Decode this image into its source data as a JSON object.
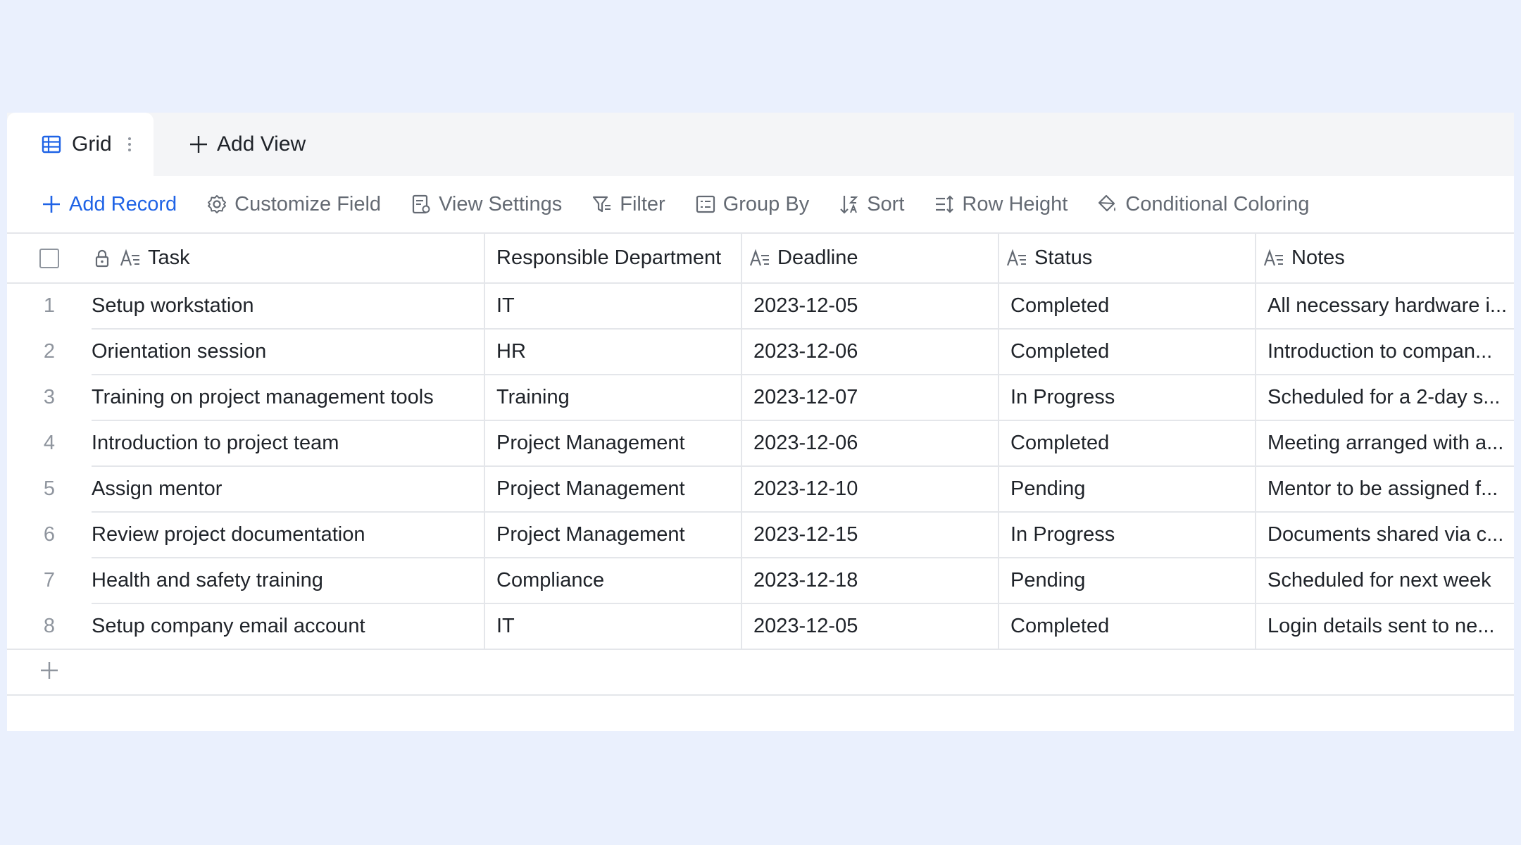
{
  "tabs": {
    "active_label": "Grid",
    "add_view_label": "Add View"
  },
  "toolbar": {
    "add_record": "Add Record",
    "customize_field": "Customize Field",
    "view_settings": "View Settings",
    "filter": "Filter",
    "group_by": "Group By",
    "sort": "Sort",
    "row_height": "Row Height",
    "conditional_coloring": "Conditional Coloring"
  },
  "table": {
    "columns": [
      "Task",
      "Responsible Department",
      "Deadline",
      "Status",
      "Notes"
    ],
    "rows": [
      {
        "index": "1",
        "task": "Setup workstation",
        "department": "IT",
        "deadline": "2023-12-05",
        "status": "Completed",
        "notes": "All necessary hardware i..."
      },
      {
        "index": "2",
        "task": "Orientation session",
        "department": "HR",
        "deadline": "2023-12-06",
        "status": "Completed",
        "notes": "Introduction to compan..."
      },
      {
        "index": "3",
        "task": "Training on project management tools",
        "department": "Training",
        "deadline": "2023-12-07",
        "status": "In Progress",
        "notes": "Scheduled for a 2-day s..."
      },
      {
        "index": "4",
        "task": "Introduction to project team",
        "department": "Project Management",
        "deadline": "2023-12-06",
        "status": "Completed",
        "notes": "Meeting arranged with a..."
      },
      {
        "index": "5",
        "task": "Assign mentor",
        "department": "Project Management",
        "deadline": "2023-12-10",
        "status": "Pending",
        "notes": "Mentor to be assigned f..."
      },
      {
        "index": "6",
        "task": "Review project documentation",
        "department": "Project Management",
        "deadline": "2023-12-15",
        "status": "In Progress",
        "notes": "Documents shared via c..."
      },
      {
        "index": "7",
        "task": "Health and safety training",
        "department": "Compliance",
        "deadline": "2023-12-18",
        "status": "Pending",
        "notes": "Scheduled for next week"
      },
      {
        "index": "8",
        "task": "Setup company email account",
        "department": "IT",
        "deadline": "2023-12-05",
        "status": "Completed",
        "notes": "Login details sent to ne..."
      }
    ]
  },
  "colors": {
    "accent": "#1f63e6",
    "background": "#eaf0fd",
    "border": "#e4e6ea",
    "muted_text": "#646a73"
  },
  "icons": [
    "grid-icon",
    "kebab-icon",
    "plus-icon",
    "gear-icon",
    "view-settings-icon",
    "filter-icon",
    "group-by-icon",
    "sort-icon",
    "row-height-icon",
    "paint-bucket-icon",
    "lock-icon",
    "text-field-icon",
    "checkbox"
  ]
}
